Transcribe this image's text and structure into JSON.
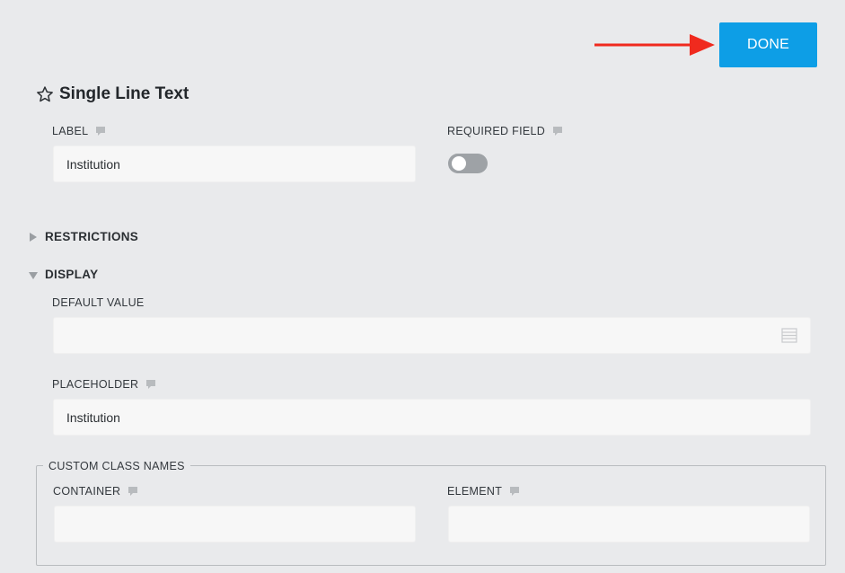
{
  "toolbar": {
    "done_label": "DONE"
  },
  "field": {
    "title": "Single Line Text",
    "label_label": "LABEL",
    "label_value": "Institution",
    "required_label": "REQUIRED FIELD",
    "required_on": false
  },
  "sections": {
    "restrictions": "RESTRICTIONS",
    "display": "DISPLAY"
  },
  "display": {
    "default_value_label": "DEFAULT VALUE",
    "default_value": "",
    "placeholder_label": "PLACEHOLDER",
    "placeholder_value": "Institution"
  },
  "custom_classes": {
    "legend": "CUSTOM CLASS NAMES",
    "container_label": "CONTAINER",
    "container_value": "",
    "element_label": "ELEMENT",
    "element_value": ""
  },
  "colors": {
    "accent": "#0d9ee6",
    "arrow": "#f02a1e",
    "background": "#e9eaec",
    "input_bg": "#f7f7f7",
    "toggle_off": "#9ea2a6"
  },
  "icons": [
    "star-icon",
    "comment-icon",
    "triangle-right-icon",
    "triangle-down-icon",
    "list-icon",
    "arrow-right-icon"
  ]
}
